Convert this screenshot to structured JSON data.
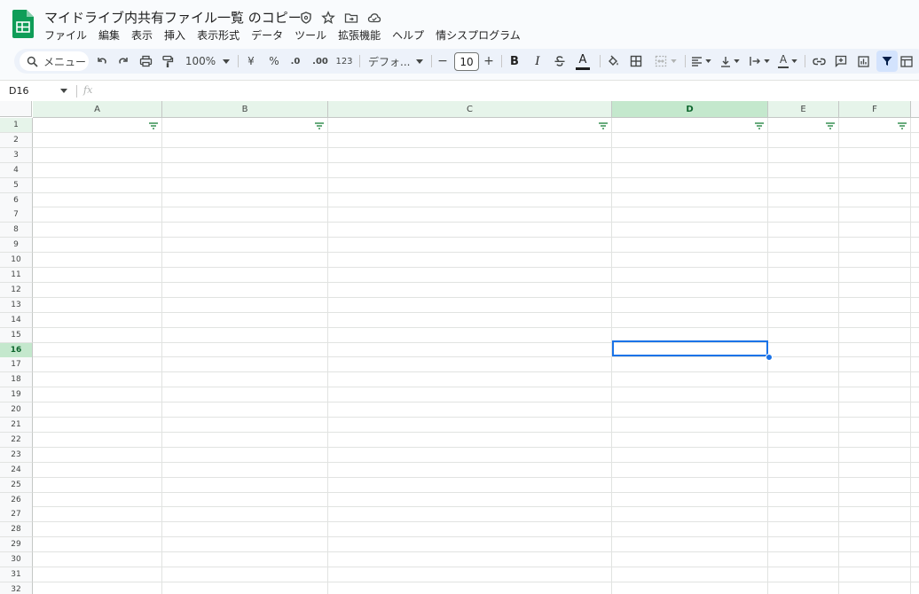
{
  "document": {
    "title": "マイドライブ内共有ファイル一覧 のコピー"
  },
  "menu": [
    "ファイル",
    "編集",
    "表示",
    "挿入",
    "表示形式",
    "データ",
    "ツール",
    "拡張機能",
    "ヘルプ",
    "情シスプログラム"
  ],
  "toolbar": {
    "search_label": "メニュー",
    "zoom": "100%",
    "currency": "¥",
    "percent": "%",
    "dec_decrease": ".0",
    "dec_increase": ".00",
    "number_format": "123",
    "font": "デフォ...",
    "minus": "−",
    "font_size": "10",
    "plus": "+",
    "bold": "B",
    "italic": "I",
    "text_color": "A",
    "text_rotation": "A"
  },
  "formula_bar": {
    "name_box": "D16",
    "fx": "fx"
  },
  "grid": {
    "columns": [
      "A",
      "B",
      "C",
      "D",
      "E",
      "F"
    ],
    "rows": [
      "1",
      "2",
      "3",
      "4",
      "5",
      "6",
      "7",
      "8",
      "9",
      "10",
      "11",
      "12",
      "13",
      "14",
      "15",
      "16",
      "17",
      "18",
      "19",
      "20",
      "21",
      "22",
      "23",
      "24",
      "25",
      "26",
      "27",
      "28",
      "29",
      "30",
      "31",
      "32"
    ],
    "selected_cell": "D16",
    "selected_column": "D",
    "selected_row": "16"
  },
  "colors": {
    "accent": "#1a73e8",
    "sheets_green": "#0f9d58",
    "selection_header": "#c4e8cd",
    "filter_header": "#e6f4ea",
    "filter_icon": "#188038"
  }
}
